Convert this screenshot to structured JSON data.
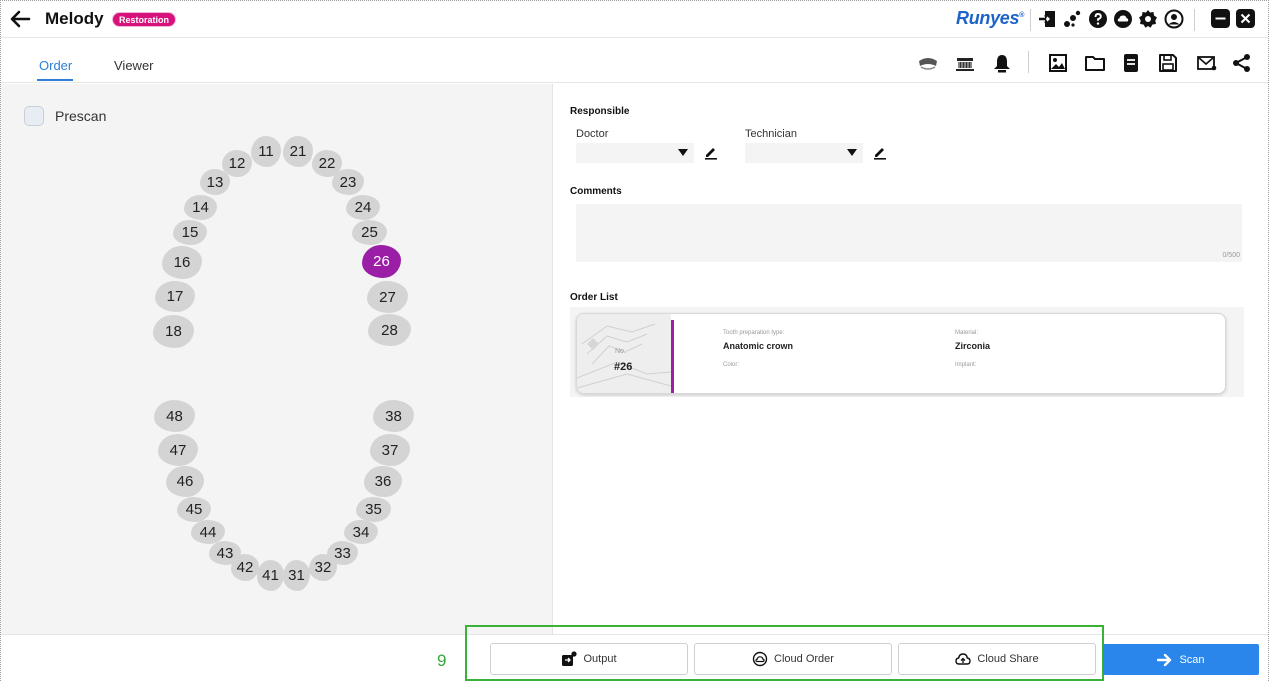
{
  "header": {
    "title": "Melody",
    "badge": "Restoration",
    "brand": "Runyes",
    "brand_mark": "®",
    "icons": [
      "back-arrow-icon",
      "login-icon",
      "sparkle-icon",
      "help-icon",
      "cloud-icon",
      "settings-icon",
      "user-icon",
      "minimize-icon",
      "close-icon"
    ]
  },
  "tabs": [
    {
      "label": "Order",
      "active": true
    },
    {
      "label": "Viewer",
      "active": false
    }
  ],
  "toolbar_icons": [
    "jaw-upper-icon",
    "jaw-lower-icon",
    "bell-icon",
    "image-icon",
    "folder-icon",
    "document-icon",
    "save-icon",
    "mail-icon",
    "share-icon"
  ],
  "left": {
    "prescan_label": "Prescan",
    "prescan_checked": false,
    "upper_teeth": [
      "18",
      "17",
      "16",
      "15",
      "14",
      "13",
      "12",
      "11",
      "21",
      "22",
      "23",
      "24",
      "25",
      "26",
      "27",
      "28"
    ],
    "lower_teeth": [
      "48",
      "47",
      "46",
      "45",
      "44",
      "43",
      "42",
      "41",
      "31",
      "32",
      "33",
      "34",
      "35",
      "36",
      "37",
      "38"
    ],
    "selected_tooth": "26"
  },
  "right": {
    "responsible_title": "Responsible",
    "doctor_label": "Doctor",
    "doctor_value": "",
    "technician_label": "Technician",
    "technician_value": "",
    "comments_title": "Comments",
    "comments_value": "",
    "comments_counter": "0/500",
    "order_list_title": "Order List",
    "order": {
      "no_label": "No.",
      "number": "#26",
      "prep_label": "Tooth preparation type:",
      "prep_value": "Anatomic crown",
      "material_label": "Material:",
      "material_value": "Zirconia",
      "color_label": "Color:",
      "implant_label": "Implant:"
    }
  },
  "bottom": {
    "annotation_number": "9",
    "output_label": "Output",
    "cloud_order_label": "Cloud Order",
    "cloud_share_label": "Cloud Share",
    "scan_label": "Scan"
  },
  "colors": {
    "accent": "#2a86ea",
    "badge": "#d6127c",
    "selected_tooth": "#9a1fa6",
    "annotation": "#3ab23a"
  }
}
